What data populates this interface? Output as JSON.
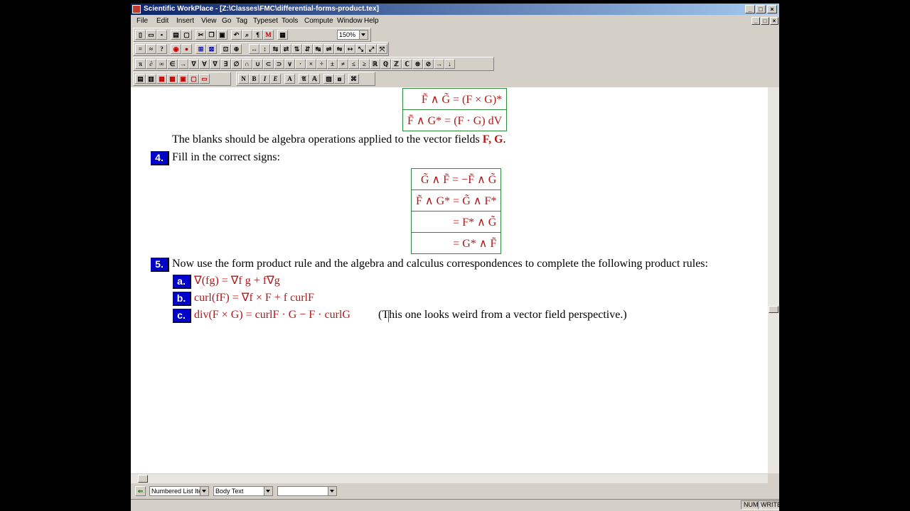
{
  "window": {
    "title": "Scientific WorkPlace - [Z:\\Classes\\FMC\\differential-forms-product.tex]",
    "buttons": {
      "min": "_",
      "max": "□",
      "close": "×"
    }
  },
  "menu": [
    "File",
    "Edit",
    "Insert",
    "View",
    "Go",
    "Tag",
    "Typeset",
    "Tools",
    "Compute",
    "Window",
    "Help"
  ],
  "toolbar": {
    "zoom": "150%"
  },
  "status": {
    "item_tag": "Numbered List Item",
    "body_tag": "Body Text",
    "third_tag": "",
    "num": "NUM",
    "write": "WRITE"
  },
  "doc": {
    "eq1": "F̃ ∧ G̃ = (F × G)*",
    "eq2": "F̃ ∧ G* = (F · G) dV",
    "blanks_text": "The blanks should be algebra operations applied to the vector fields ",
    "blanks_math": "F, G",
    "blanks_end": ".",
    "q4_num": "4.",
    "q4_text": "Fill in the correct signs:",
    "t1": "G̃ ∧ F̃ = −F̃ ∧ G̃",
    "t2": "F̃ ∧ G* = G̃ ∧ F*",
    "t3": "= F* ∧ G̃",
    "t4": "= G* ∧ F̃",
    "q5_num": "5.",
    "q5_text": "Now use the form product rule and the algebra and calculus correspondences to complete the following product rules:",
    "a_label": "a.",
    "a_math": "∇(fg) = ∇f g + f∇g",
    "b_label": "b.",
    "b_math": "curl(fF) = ∇f × F + f curlF",
    "c_label": "c.",
    "c_math": "div(F × G) = curlF · G − F · curlG",
    "c_note": "(This one looks weird from a vector field perspective.)"
  }
}
